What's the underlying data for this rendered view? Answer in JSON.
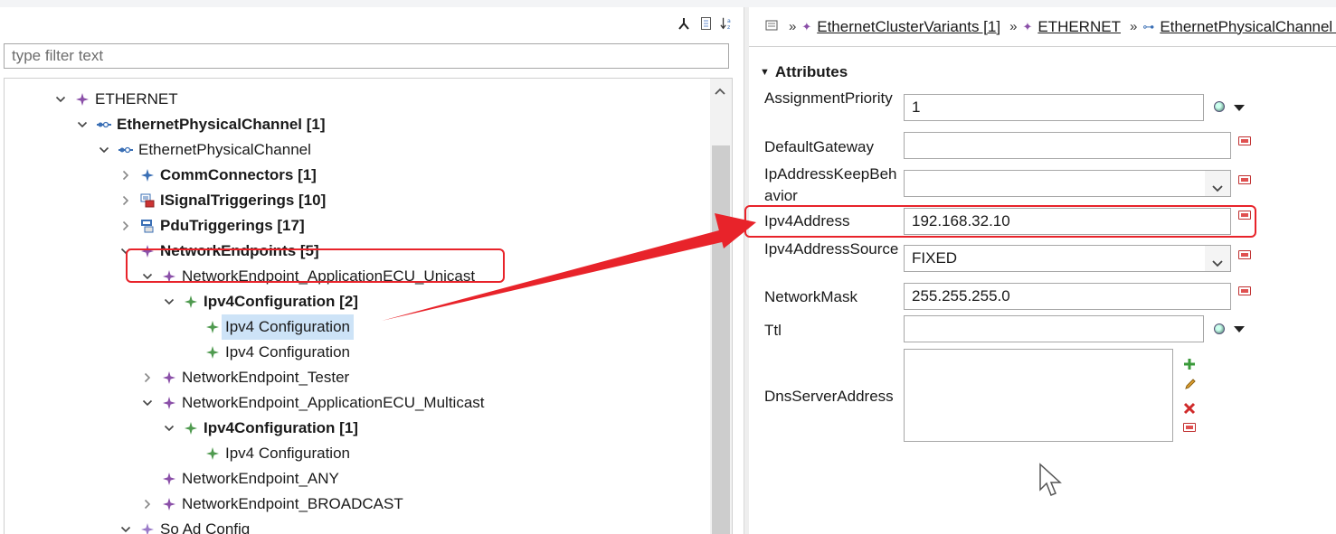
{
  "left_panel": {
    "toolbar": [
      {
        "name": "link-editor-icon",
        "glyph": "⅄"
      },
      {
        "name": "document-icon",
        "glyph": "🗎"
      },
      {
        "name": "sort-az-icon",
        "glyph": "↓ᵃᶻ"
      }
    ],
    "filter": {
      "placeholder": "type filter text",
      "value": ""
    },
    "tree": [
      {
        "depth": 0,
        "twisty": "open",
        "icon": "purple-diamond-icon",
        "label": "ETHERNET",
        "bold": false
      },
      {
        "depth": 1,
        "twisty": "open",
        "icon": "channel-icon",
        "label": "EthernetPhysicalChannel [1]",
        "bold": true
      },
      {
        "depth": 2,
        "twisty": "open",
        "icon": "channel-icon",
        "label": "EthernetPhysicalChannel",
        "bold": false
      },
      {
        "depth": 3,
        "twisty": "closed",
        "icon": "blue-diamond-icon",
        "label": "CommConnectors [1]",
        "bold": true
      },
      {
        "depth": 3,
        "twisty": "closed",
        "icon": "signal-trigger-icon",
        "label": "ISignalTriggerings [10]",
        "bold": true
      },
      {
        "depth": 3,
        "twisty": "closed",
        "icon": "pdu-trigger-icon",
        "label": "PduTriggerings [17]",
        "bold": true
      },
      {
        "depth": 3,
        "twisty": "open",
        "icon": "purple-diamond-icon",
        "label": "NetworkEndpoints [5]",
        "bold": true
      },
      {
        "depth": 4,
        "twisty": "open",
        "icon": "purple-diamond-icon",
        "label": "NetworkEndpoint_ApplicationECU_Unicast",
        "bold": false
      },
      {
        "depth": 5,
        "twisty": "open",
        "icon": "green-diamond-icon",
        "label": "Ipv4Configuration [2]",
        "bold": true
      },
      {
        "depth": 6,
        "twisty": "none",
        "icon": "green-diamond-icon",
        "label": "Ipv4 Configuration",
        "bold": false,
        "selected": true
      },
      {
        "depth": 6,
        "twisty": "none",
        "icon": "green-diamond-icon",
        "label": "Ipv4 Configuration",
        "bold": false
      },
      {
        "depth": 4,
        "twisty": "closed",
        "icon": "purple-diamond-icon",
        "label": "NetworkEndpoint_Tester",
        "bold": false
      },
      {
        "depth": 4,
        "twisty": "open",
        "icon": "purple-diamond-icon",
        "label": "NetworkEndpoint_ApplicationECU_Multicast",
        "bold": false
      },
      {
        "depth": 5,
        "twisty": "open",
        "icon": "green-diamond-icon",
        "label": "Ipv4Configuration [1]",
        "bold": true
      },
      {
        "depth": 6,
        "twisty": "none",
        "icon": "green-diamond-icon",
        "label": "Ipv4 Configuration",
        "bold": false
      },
      {
        "depth": 4,
        "twisty": "none",
        "icon": "purple-diamond-icon",
        "label": "NetworkEndpoint_ANY",
        "bold": false
      },
      {
        "depth": 4,
        "twisty": "closed",
        "icon": "purple-diamond-icon",
        "label": "NetworkEndpoint_BROADCAST",
        "bold": false
      },
      {
        "depth": 3,
        "twisty": "open",
        "icon": "lavender-diamond-icon",
        "label": "So Ad Config",
        "bold": false
      }
    ]
  },
  "right_panel": {
    "breadcrumb": [
      {
        "label": "EthernetClusterVariants [1]",
        "icon": "purple-diamond-icon"
      },
      {
        "label": "ETHERNET",
        "icon": "purple-diamond-icon"
      },
      {
        "label": "EthernetPhysicalChannel [",
        "icon": "channel-icon"
      }
    ],
    "section_title": "Attributes",
    "fields": {
      "assignment_priority": {
        "label": "AssignmentPriority",
        "value": "1"
      },
      "default_gateway": {
        "label": "DefaultGateway",
        "value": ""
      },
      "ip_address_keep_behavior": {
        "label": "IpAddressKeepBehavior",
        "value": ""
      },
      "ipv4_address": {
        "label": "Ipv4Address",
        "value": "192.168.32.10"
      },
      "ipv4_address_source": {
        "label": "Ipv4AddressSource",
        "value": "FIXED"
      },
      "network_mask": {
        "label": "NetworkMask",
        "value": "255.255.255.0"
      },
      "ttl": {
        "label": "Ttl",
        "value": ""
      },
      "dns_server_address": {
        "label": "DnsServerAddress",
        "items": []
      }
    }
  },
  "colors": {
    "highlight_red": "#e8232a",
    "selection": "#cde3f7",
    "purple_icon": "#8a4fa8",
    "green_icon": "#4f9a4f",
    "blue_icon": "#3a6fb5"
  }
}
